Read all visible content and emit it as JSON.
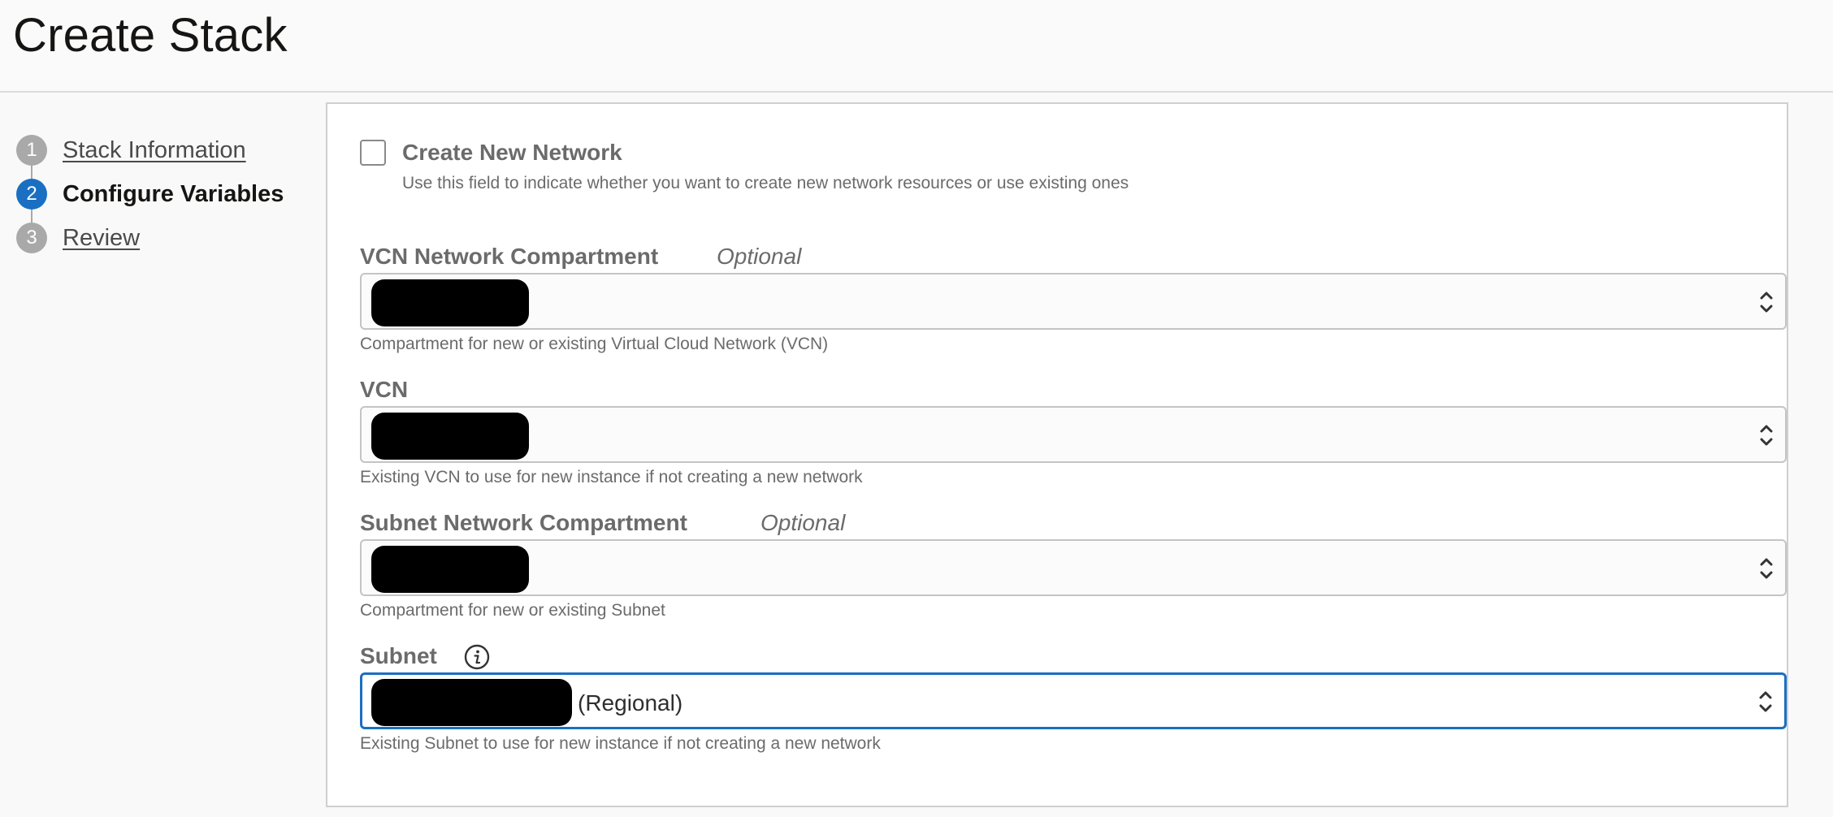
{
  "page": {
    "title": "Create Stack"
  },
  "steps": [
    {
      "number": "1",
      "label": "Stack Information",
      "state": "completed"
    },
    {
      "number": "2",
      "label": "Configure Variables",
      "state": "current"
    },
    {
      "number": "3",
      "label": "Review",
      "state": "upcoming"
    }
  ],
  "form": {
    "create_network": {
      "label": "Create New Network",
      "help": "Use this field to indicate whether you want to create new network resources or use existing ones",
      "checked": false
    },
    "vcn_compartment": {
      "label": "VCN Network Compartment",
      "optional": "Optional",
      "help": "Compartment for new or existing Virtual Cloud Network (VCN)"
    },
    "vcn": {
      "label": "VCN",
      "help": "Existing VCN to use for new instance if not creating a new network"
    },
    "subnet_compartment": {
      "label": "Subnet Network Compartment",
      "optional": "Optional",
      "help": "Compartment for new or existing Subnet"
    },
    "subnet": {
      "label": "Subnet",
      "value_suffix": "(Regional)",
      "help": "Existing Subnet to use for new instance if not creating a new network"
    }
  },
  "colors": {
    "accent": "#1b6fc2",
    "step_inactive": "#a9a9a9",
    "label_gray": "#6b6b6b"
  }
}
